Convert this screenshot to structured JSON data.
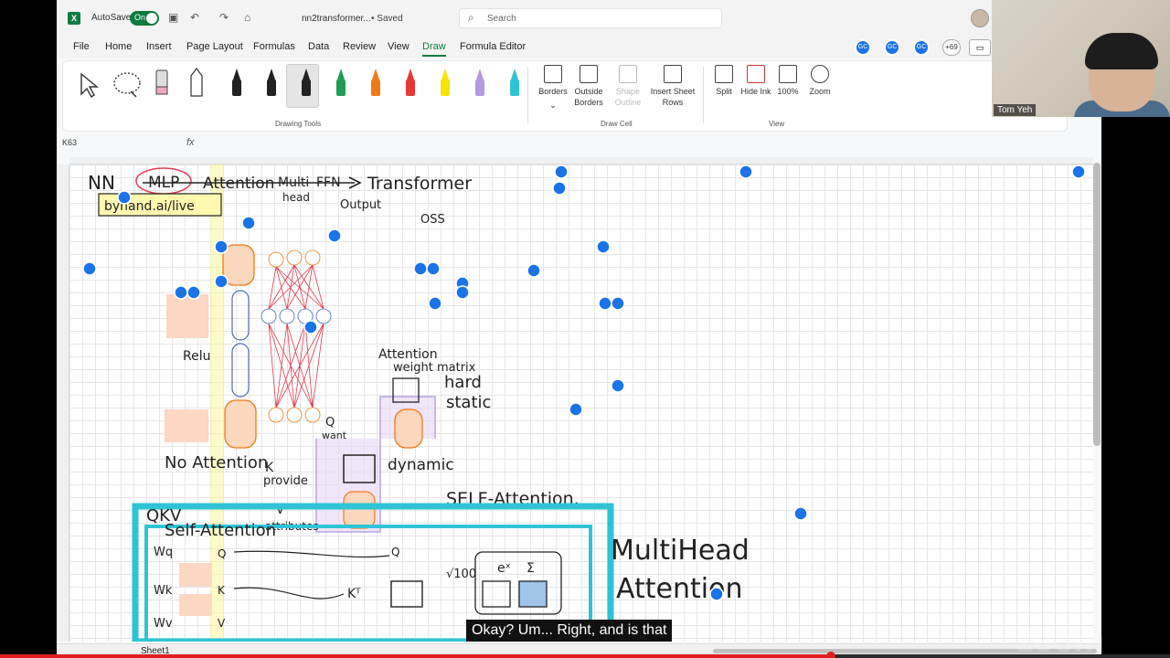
{
  "titlebar": {
    "autosave_label": "AutoSave",
    "autosave_state": "On",
    "doc_title": "nn2transformer...",
    "saved": "• Saved",
    "search_placeholder": "Search"
  },
  "menu": {
    "tabs": [
      "File",
      "Home",
      "Insert",
      "Page Layout",
      "Formulas",
      "Data",
      "Review",
      "View",
      "Draw",
      "Formula Editor"
    ],
    "active_tab": "Draw",
    "presence_initials": "GC",
    "extra_count": "+69"
  },
  "ribbon": {
    "pen_colors": [
      "#222222",
      "#222222",
      "#222222",
      "#1f9d55",
      "#f07a17",
      "#e53935",
      "#f4e409",
      "#b29be0",
      "#2ec4d6"
    ],
    "drawing_tools_label": "Drawing Tools",
    "draw_cell": {
      "label": "Draw Cell",
      "buttons": [
        "Borders",
        "Outside Borders",
        "Shape Outline",
        "Insert Sheet Rows"
      ]
    },
    "view": {
      "label": "View",
      "buttons": [
        "Split",
        "Hide Ink",
        "100%",
        "Zoom"
      ]
    }
  },
  "formula_bar": {
    "namebox": "K63",
    "fx": "fx"
  },
  "ink": {
    "title_line": "NN",
    "mlp": "MLP",
    "attention": "Attention",
    "multi": "Multi",
    "ffn": "FFN",
    "arrow_transformer": "Transformer",
    "head": "head",
    "output": "Output",
    "oss": "OSS",
    "byhand": "byhand.ai/live",
    "relu": "Relu",
    "no_attention": "No Attention",
    "attention_weight": "Attention",
    "weight_matrix": "weight matrix",
    "hard": "hard",
    "static": "static",
    "dynamic": "dynamic",
    "q_label": "Q",
    "want": "want",
    "k_label": "K",
    "provide": "provide",
    "v_label": "V",
    "attributes": "attributes",
    "self_attention_right": "SELF-Attention.",
    "qkv": "QKV",
    "self_attention_left": "Self-Attention",
    "wq": "Wq",
    "wk": "Wk",
    "wv": "Wv",
    "q2": "Q",
    "k2": "K",
    "v2": "V",
    "kt": "Kᵀ",
    "sqrt": "√100",
    "exp": "eˣ",
    "sum": "Σ",
    "multihead1": "MultiHead",
    "multihead2": "Attention"
  },
  "sheet": {
    "tab": "Sheet1"
  },
  "video": {
    "participant_name": "Tom Yeh",
    "caption": "Okay? Um... Right, and is that",
    "watermark": "zoom",
    "progress_fraction": 0.71
  }
}
